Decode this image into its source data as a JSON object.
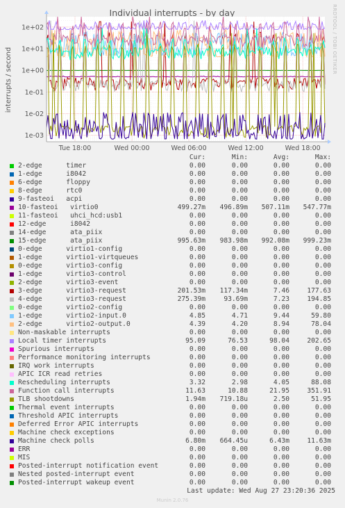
{
  "chart_data": {
    "type": "line",
    "title": "Individual interrupts - by day",
    "ylabel": "interrupts / second",
    "xlabel": "",
    "yscale": "log",
    "ylim": [
      0.0005,
      300
    ],
    "y_ticks": [
      "1e-03",
      "1e-02",
      "1e-01",
      "1e+00",
      "1e+01",
      "1e+02"
    ],
    "x_ticks": [
      "Tue 18:00",
      "Wed 00:00",
      "Wed 06:00",
      "Wed 12:00",
      "Wed 18:00"
    ],
    "grid": true,
    "legend_position": "bottom",
    "columns": [
      "Cur:",
      "Min:",
      "Avg:",
      "Max:"
    ],
    "series": [
      {
        "name": "2-edge      timer",
        "color": "#00cc00",
        "cur": "0.00",
        "min": "0.00",
        "avg": "0.00",
        "max": "0.00"
      },
      {
        "name": "1-edge      i8042",
        "color": "#0066b3",
        "cur": "0.00",
        "min": "0.00",
        "avg": "0.00",
        "max": "0.00"
      },
      {
        "name": "6-edge      floppy",
        "color": "#ff8000",
        "cur": "0.00",
        "min": "0.00",
        "avg": "0.00",
        "max": "0.00"
      },
      {
        "name": "8-edge      rtc0",
        "color": "#ffcc00",
        "cur": "0.00",
        "min": "0.00",
        "avg": "0.00",
        "max": "0.00"
      },
      {
        "name": "9-fasteoi   acpi",
        "color": "#330099",
        "cur": "0.00",
        "min": "0.00",
        "avg": "0.00",
        "max": "0.00"
      },
      {
        "name": "10-fasteoi   virtio0",
        "color": "#990099",
        "cur": "499.27m",
        "min": "496.89m",
        "avg": "507.11m",
        "max": "547.77m"
      },
      {
        "name": "11-fasteoi   uhci_hcd:usb1",
        "color": "#ccff00",
        "cur": "0.00",
        "min": "0.00",
        "avg": "0.00",
        "max": "0.00"
      },
      {
        "name": "12-edge      i8042",
        "color": "#ff0000",
        "cur": "0.00",
        "min": "0.00",
        "avg": "0.00",
        "max": "0.00"
      },
      {
        "name": "14-edge      ata_piix",
        "color": "#808080",
        "cur": "0.00",
        "min": "0.00",
        "avg": "0.00",
        "max": "0.00"
      },
      {
        "name": "15-edge      ata_piix",
        "color": "#008f00",
        "cur": "995.63m",
        "min": "983.98m",
        "avg": "992.08m",
        "max": "999.23m"
      },
      {
        "name": "0-edge      virtio1-config",
        "color": "#00487d",
        "cur": "0.00",
        "min": "0.00",
        "avg": "0.00",
        "max": "0.00"
      },
      {
        "name": "1-edge      virtio1-virtqueues",
        "color": "#b35a00",
        "cur": "0.00",
        "min": "0.00",
        "avg": "0.00",
        "max": "0.00"
      },
      {
        "name": "0-edge      virtio3-config",
        "color": "#b38f00",
        "cur": "0.00",
        "min": "0.00",
        "avg": "0.00",
        "max": "0.00"
      },
      {
        "name": "1-edge      virtio3-control",
        "color": "#6b006b",
        "cur": "0.00",
        "min": "0.00",
        "avg": "0.00",
        "max": "0.00"
      },
      {
        "name": "2-edge      virtio3-event",
        "color": "#8fb300",
        "cur": "0.00",
        "min": "0.00",
        "avg": "0.00",
        "max": "0.00"
      },
      {
        "name": "3-edge      virtio3-request",
        "color": "#b30000",
        "cur": "201.53m",
        "min": "117.34m",
        "avg": "7.46",
        "max": "177.63"
      },
      {
        "name": "4-edge      virtio3-request",
        "color": "#bebebe",
        "cur": "275.39m",
        "min": "93.69m",
        "avg": "7.23",
        "max": "194.85"
      },
      {
        "name": "0-edge      virtio2-config",
        "color": "#80ff80",
        "cur": "0.00",
        "min": "0.00",
        "avg": "0.00",
        "max": "0.00"
      },
      {
        "name": "1-edge      virtio2-input.0",
        "color": "#80c9ff",
        "cur": "4.85",
        "min": "4.71",
        "avg": "9.44",
        "max": "59.80"
      },
      {
        "name": "2-edge      virtio2-output.0",
        "color": "#ffc080",
        "cur": "4.39",
        "min": "4.20",
        "avg": "8.94",
        "max": "78.04"
      },
      {
        "name": "Non-maskable interrupts",
        "color": "#ffe680",
        "cur": "0.00",
        "min": "0.00",
        "avg": "0.00",
        "max": "0.00"
      },
      {
        "name": "Local timer interrupts",
        "color": "#aa80ff",
        "cur": "95.09",
        "min": "76.53",
        "avg": "98.04",
        "max": "202.65"
      },
      {
        "name": "Spurious interrupts",
        "color": "#ee00cc",
        "cur": "0.00",
        "min": "0.00",
        "avg": "0.00",
        "max": "0.00"
      },
      {
        "name": "Performance monitoring interrupts",
        "color": "#ff8080",
        "cur": "0.00",
        "min": "0.00",
        "avg": "0.00",
        "max": "0.00"
      },
      {
        "name": "IRQ work interrupts",
        "color": "#666600",
        "cur": "0.00",
        "min": "0.00",
        "avg": "0.00",
        "max": "0.00"
      },
      {
        "name": "APIC ICR read retries",
        "color": "#ffbfff",
        "cur": "0.00",
        "min": "0.00",
        "avg": "0.00",
        "max": "0.00"
      },
      {
        "name": "Rescheduling interrupts",
        "color": "#00ffcc",
        "cur": "3.32",
        "min": "2.98",
        "avg": "4.05",
        "max": "88.08"
      },
      {
        "name": "Function call interrupts",
        "color": "#cc6699",
        "cur": "11.63",
        "min": "10.88",
        "avg": "21.95",
        "max": "351.91"
      },
      {
        "name": "TLB shootdowns",
        "color": "#999900",
        "cur": "1.94m",
        "min": "719.18u",
        "avg": "2.50",
        "max": "51.95"
      },
      {
        "name": "Thermal event interrupts",
        "color": "#00cc00",
        "cur": "0.00",
        "min": "0.00",
        "avg": "0.00",
        "max": "0.00"
      },
      {
        "name": "Threshold APIC interrupts",
        "color": "#0066b3",
        "cur": "0.00",
        "min": "0.00",
        "avg": "0.00",
        "max": "0.00"
      },
      {
        "name": "Deferred Error APIC interrupts",
        "color": "#ff8000",
        "cur": "0.00",
        "min": "0.00",
        "avg": "0.00",
        "max": "0.00"
      },
      {
        "name": "Machine check exceptions",
        "color": "#ffcc00",
        "cur": "0.00",
        "min": "0.00",
        "avg": "0.00",
        "max": "0.00"
      },
      {
        "name": "Machine check polls",
        "color": "#330099",
        "cur": "6.80m",
        "min": "664.45u",
        "avg": "6.43m",
        "max": "11.63m"
      },
      {
        "name": "ERR",
        "color": "#990099",
        "cur": "0.00",
        "min": "0.00",
        "avg": "0.00",
        "max": "0.00"
      },
      {
        "name": "MIS",
        "color": "#ccff00",
        "cur": "0.00",
        "min": "0.00",
        "avg": "0.00",
        "max": "0.00"
      },
      {
        "name": "Posted-interrupt notification event",
        "color": "#ff0000",
        "cur": "0.00",
        "min": "0.00",
        "avg": "0.00",
        "max": "0.00"
      },
      {
        "name": "Nested posted-interrupt event",
        "color": "#808080",
        "cur": "0.00",
        "min": "0.00",
        "avg": "0.00",
        "max": "0.00"
      },
      {
        "name": "Posted-interrupt wakeup event",
        "color": "#008f00",
        "cur": "0.00",
        "min": "0.00",
        "avg": "0.00",
        "max": "0.00"
      }
    ]
  },
  "footer": {
    "last_update": "Last update: Wed Aug 27 23:20:36 2025",
    "watermark": "Munin 2.0.76",
    "side_label": "RRDTOOL / TOBI OETIKER"
  }
}
